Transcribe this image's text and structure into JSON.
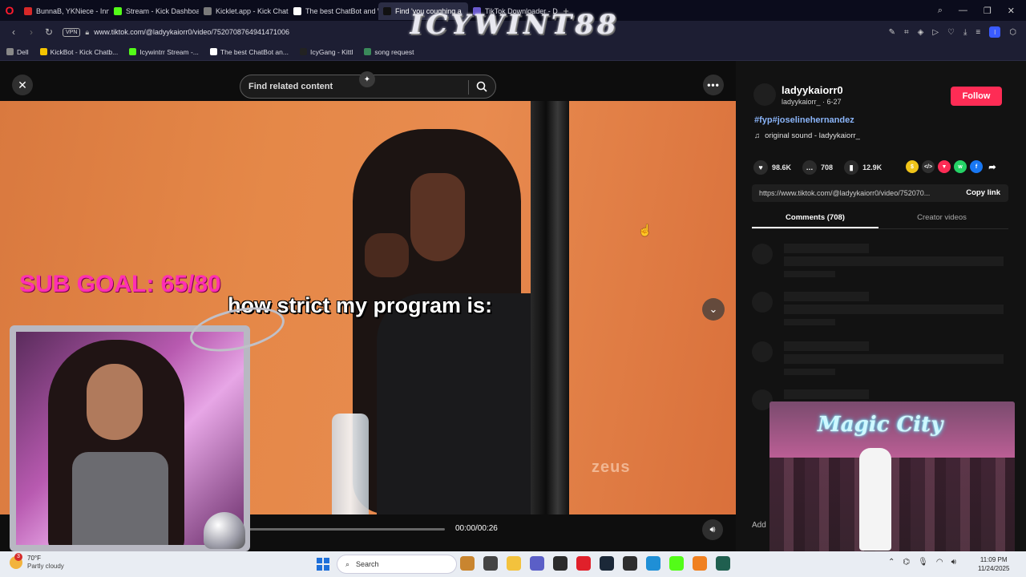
{
  "browser": {
    "tabs": [
      {
        "label": "BunnaB, YKNiece - Innit (C",
        "color": "#d62828"
      },
      {
        "label": "Stream - Kick Dashboard",
        "color": "#53fc18"
      },
      {
        "label": "Kicklet.app - Kick Chatbot",
        "color": "#7a7a7a"
      },
      {
        "label": "The best ChatBot and Wid",
        "color": "#ffffff"
      },
      {
        "label": "Find 'you coughing a",
        "color": "#111111"
      },
      {
        "label": "TikTok Downloader - Dow",
        "color": "#6a5acd"
      }
    ],
    "active_tab_index": 4,
    "url": "www.tiktok.com/@ladyykaiorr0/video/7520708764941471006",
    "vpn_label": "VPN",
    "profile_letter": "I",
    "bookmarks": [
      {
        "label": "Dell",
        "color": "#888888"
      },
      {
        "label": "KickBot - Kick Chatb...",
        "color": "#f5c400"
      },
      {
        "label": "Icywintrr Stream -...",
        "color": "#53fc18"
      },
      {
        "label": "The best ChatBot an...",
        "color": "#ffffff"
      },
      {
        "label": "IcyGang - Kittl",
        "color": "#222222"
      },
      {
        "label": "song request",
        "color": "#3a8a5a"
      }
    ]
  },
  "overlay": {
    "banner": "ICYWINT88",
    "sub_goal": "SUB GOAL: 65/80"
  },
  "tiktok": {
    "search_placeholder": "Find related content",
    "video": {
      "caption": "how strict my program is:",
      "watermark": "zeus",
      "timecode": "00:00/00:26",
      "progress": 0
    },
    "author": {
      "username": "ladyykaiorr0",
      "subline": "ladyykaiorr_ · 6-27",
      "follow_label": "Follow"
    },
    "hashtags": "#fyp#joselinehernandez",
    "sound": "original sound - ladyykaiorr_",
    "stats": {
      "likes": "98.6K",
      "comments": "708",
      "saves": "12.9K"
    },
    "link": "https://www.tiktok.com/@ladyykaiorr0/video/752070...",
    "copy_link": "Copy link",
    "tabs": {
      "comments": "Comments (708)",
      "creator": "Creator videos"
    },
    "add_comment": "Add",
    "pip_title": "Magic City"
  },
  "taskbar": {
    "weather_temp": "70°F",
    "weather_desc": "Partly cloudy",
    "notification_count": "3",
    "search_label": "Search",
    "time": "11:09 PM",
    "date": "11/24/2025",
    "apps": [
      {
        "name": "thanksgiving-widget",
        "color": "#c9852f"
      },
      {
        "name": "task-view",
        "color": "#444444"
      },
      {
        "name": "file-explorer",
        "color": "#f3c23d"
      },
      {
        "name": "chat",
        "color": "#5b5fc7"
      },
      {
        "name": "obs",
        "color": "#2b2b2b"
      },
      {
        "name": "opera",
        "color": "#e0202a"
      },
      {
        "name": "steam",
        "color": "#1b2838"
      },
      {
        "name": "xbox",
        "color": "#2e2e2e"
      },
      {
        "name": "edge",
        "color": "#1f8fd6"
      },
      {
        "name": "kick",
        "color": "#53fc18"
      },
      {
        "name": "app-orange",
        "color": "#f08020"
      },
      {
        "name": "app-green",
        "color": "#1f5f4f"
      }
    ]
  }
}
